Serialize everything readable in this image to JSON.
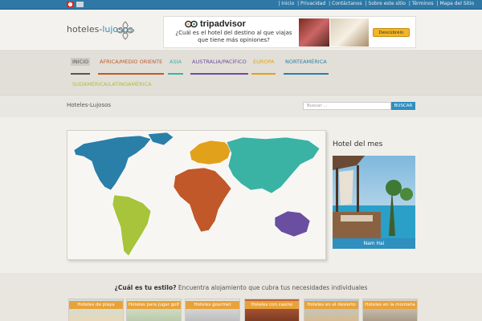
{
  "topbar": {
    "links": [
      "| Inicio",
      "| Privacidad",
      "| Contáctanos",
      "| Sobre este sitio",
      "| Términos",
      "| Mapa del Sitio"
    ]
  },
  "logo": {
    "part1": "hoteles-",
    "part2": "lujosos"
  },
  "ad": {
    "brand": "tripadvisor",
    "question": "¿Cuál es el hotel del destino al que viajas que tiene más opiniones?",
    "button": "Descúbrelo"
  },
  "nav": {
    "items": [
      {
        "label": "INICIO",
        "color": "#555555"
      },
      {
        "label": "ÁFRICA/MEDIO ORIENTE",
        "color": "#c1582a"
      },
      {
        "label": "ASIA",
        "color": "#3ab3a4"
      },
      {
        "label": "AUSTRALIA/PACÍFICO",
        "color": "#6a4fa0"
      },
      {
        "label": "EUROPA",
        "color": "#e2a11a"
      },
      {
        "label": "NORTEAMÉRICA",
        "color": "#2a7fa8"
      },
      {
        "label": "SUDAMÉRICA/LATINOAMÉRICA",
        "color": "#a7c43a"
      }
    ]
  },
  "breadcrumb": "Hoteles-Lujosos",
  "search": {
    "placeholder": "Buscar ...",
    "button": "BUSCAR"
  },
  "colors": {
    "north_america": "#2a7fa8",
    "south_america": "#a7c43a",
    "europe": "#e2a11a",
    "africa": "#c1582a",
    "asia": "#3ab3a4",
    "australia": "#6a4fa0",
    "accent": "#2f8fbf"
  },
  "hotel_of_month": {
    "title": "Hotel del mes",
    "name": "Nam Hai"
  },
  "styles": {
    "question": "¿Cuál es tu estilo?",
    "subtitle": "Encuentra alojamiento que cubra tus necesidades individuales",
    "categories": [
      "Hoteles de playa",
      "Hoteles para jugar golf",
      "Hoteles gourmet",
      "Hoteles con casino",
      "Hoteles en el desierto",
      "Hoteles en la montaña"
    ]
  }
}
